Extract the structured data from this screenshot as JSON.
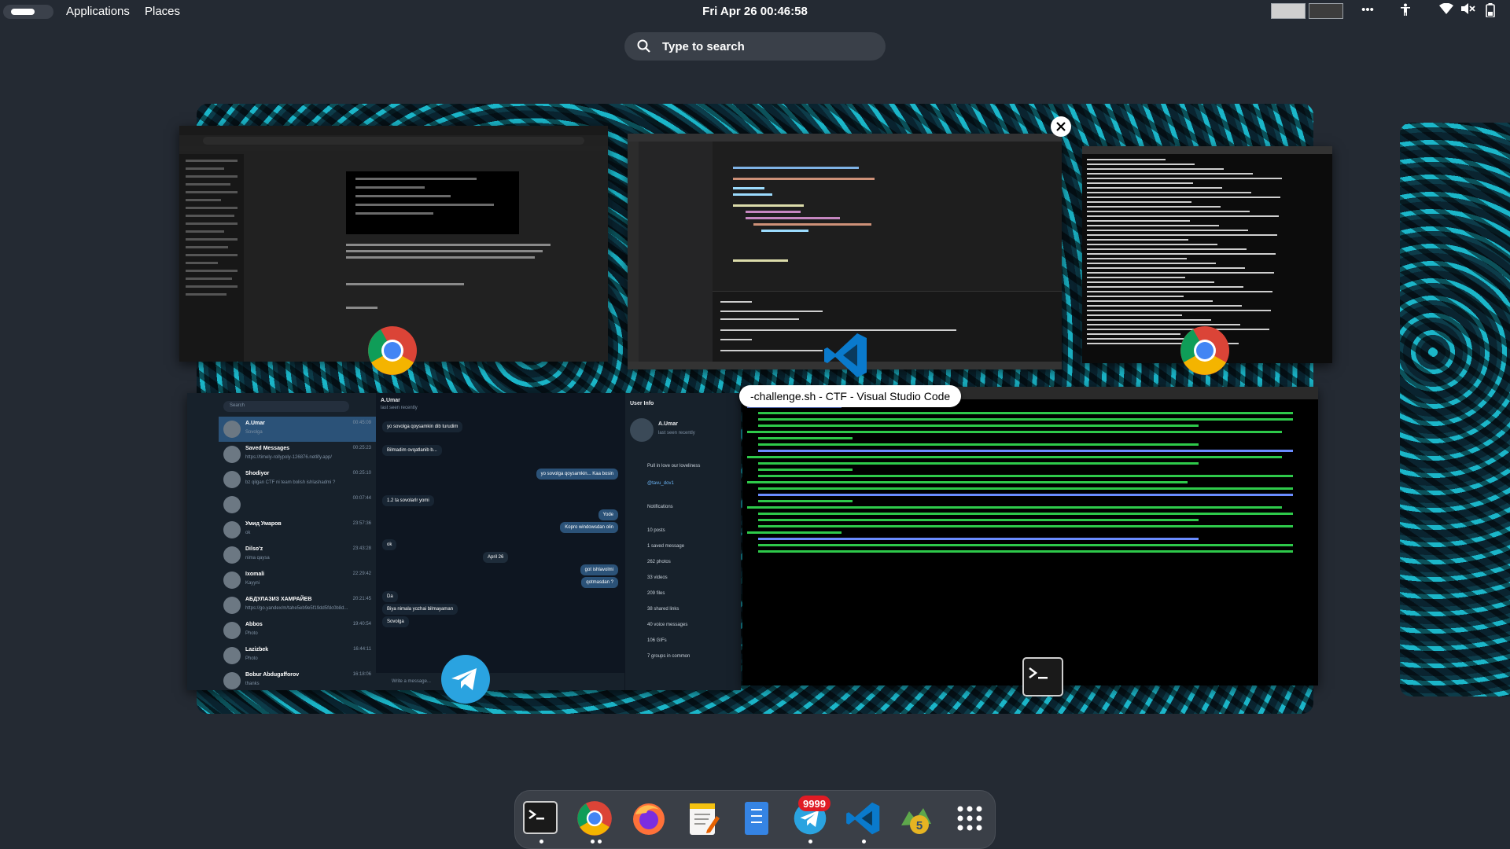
{
  "topbar": {
    "applications": "Applications",
    "places": "Places",
    "clock": "Fri Apr 26  00:46:58",
    "tray_icons": [
      "more-icon",
      "accessibility-icon",
      "wifi-icon",
      "mute-icon",
      "battery-icon"
    ]
  },
  "search": {
    "placeholder": "Type to search"
  },
  "overview": {
    "tooltip": "-challenge.sh - CTF - Visual Studio Code",
    "windows": [
      "chrome-chatgpt",
      "vscode-challenge",
      "chrome-terminal",
      "telegram",
      "terminal"
    ]
  },
  "telegram": {
    "search": "Search",
    "chats": [
      {
        "name": "A.Umar",
        "preview": "Sovolga",
        "time": "00:45:09"
      },
      {
        "name": "Saved Messages",
        "preview": "https://timely-rollypoly-126876.netlify.app/",
        "time": "00:25:23"
      },
      {
        "name": "Shodiyor",
        "preview": "bz qilgan CTF ni team bolish ishlashadmi ?",
        "time": "00:25:10"
      },
      {
        "name": "",
        "preview": "",
        "time": "00:07:44"
      },
      {
        "name": "Умид Умаров",
        "preview": "ok",
        "time": "23:57:36"
      },
      {
        "name": "Dilso'z",
        "preview": "nima qaysa",
        "time": "23:43:28"
      },
      {
        "name": "Ixomali",
        "preview": "Kayyni",
        "time": "22:29:42"
      },
      {
        "name": "АБДУЛАЗИЗ ХАМРАЙЕВ",
        "preview": "https://go.yandex/m/tahe5eb9e5f19dd5fdc0b8d...",
        "time": "20:21:45"
      },
      {
        "name": "Abbos",
        "preview": "Photo",
        "time": "19:40:54"
      },
      {
        "name": "Lazizbek",
        "preview": "Photo",
        "time": "16:44:11"
      },
      {
        "name": "Bobur Abdugafforov",
        "preview": "thanks",
        "time": "16:18:06"
      }
    ],
    "chat_title": "A.Umar",
    "chat_status": "last seen recently",
    "messages": [
      {
        "text": "yo sovolga qoysamkin dib turudim",
        "dir": "in"
      },
      {
        "text": "Bilmadim ovqatlanib b...",
        "dir": "in"
      },
      {
        "text": "yo sovolga qoysamkin... Kaa bosin",
        "dir": "out"
      },
      {
        "text": "1.2 ta sovolarlr yomi",
        "dir": "in"
      },
      {
        "text": "Yode",
        "dir": "out"
      },
      {
        "text": "Kopro windowsdan olin",
        "dir": "out"
      },
      {
        "text": "ok",
        "dir": "in"
      },
      {
        "text": "April 26",
        "dir": "date"
      },
      {
        "text": "got ishlavolmi",
        "dir": "out"
      },
      {
        "text": "qotmasdan ?",
        "dir": "out"
      },
      {
        "text": "Da",
        "dir": "in"
      },
      {
        "text": "Biya nimala yozhai bilmayaman",
        "dir": "in"
      },
      {
        "text": "Sovolga",
        "dir": "in"
      }
    ],
    "composer_placeholder": "Write a message...",
    "info": {
      "title": "User Info",
      "name": "A.Umar",
      "status": "last seen recently",
      "bio": "Pull in love our loveliness",
      "username": "@tavu_dov1",
      "notifications": "Notifications",
      "stats": [
        "10 posts",
        "1 saved message",
        "262 photos",
        "33 videos",
        "209 files",
        "38 shared links",
        "40 voice messages",
        "106 GIFs",
        "7 groups in common"
      ]
    }
  },
  "dock": {
    "apps": [
      "terminal-icon",
      "chrome-icon",
      "firefox-icon",
      "text-editor-icon",
      "files-icon",
      "telegram-icon",
      "vscode-icon",
      "metatrader-icon",
      "app-grid-icon"
    ],
    "telegram_badge": "9999"
  },
  "colors": {
    "background": "#242a33",
    "accent_chrome_red": "#ea4335",
    "telegram_blue": "#2aa3e0",
    "vscode_blue": "#0a7acc"
  }
}
